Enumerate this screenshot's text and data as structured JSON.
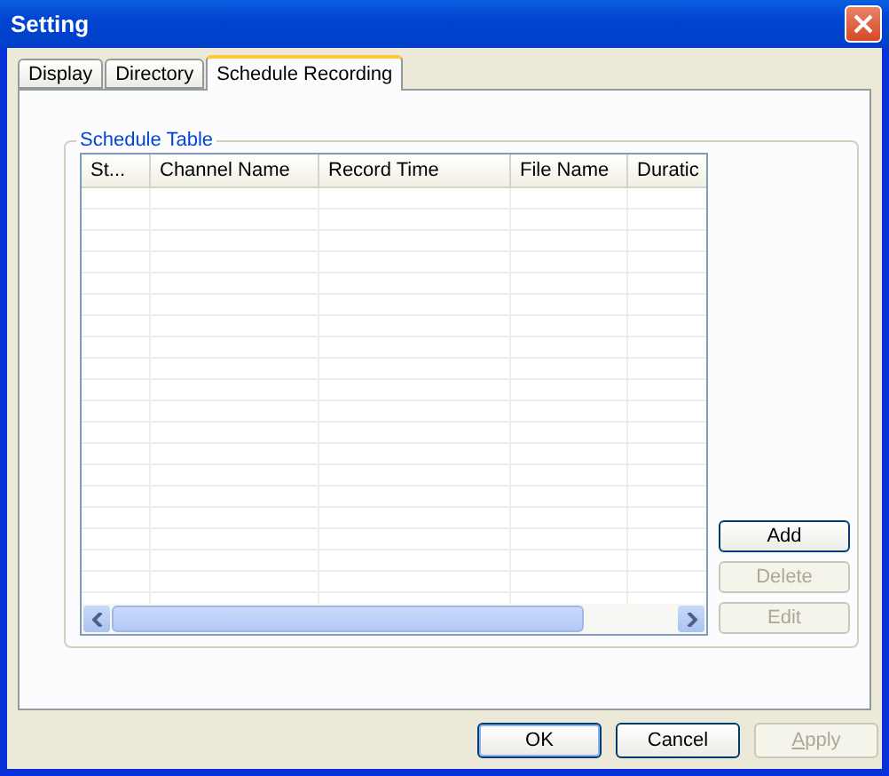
{
  "window": {
    "title": "Setting"
  },
  "tabs": [
    {
      "label": "Display",
      "selected": false
    },
    {
      "label": "Directory",
      "selected": false
    },
    {
      "label": "Schedule Recording",
      "selected": true
    }
  ],
  "group": {
    "label": "Schedule Table"
  },
  "table": {
    "columns": [
      "St...",
      "Channel Name",
      "Record Time",
      "File Name",
      "Duratic"
    ]
  },
  "side_buttons": [
    {
      "label": "Add",
      "disabled": false
    },
    {
      "label": "Delete",
      "disabled": true
    },
    {
      "label": "Edit",
      "disabled": true
    }
  ],
  "buttons": [
    {
      "label": "OK",
      "disabled": false,
      "default": true,
      "underline_first": false
    },
    {
      "label": "Cancel",
      "disabled": false,
      "default": false,
      "underline_first": false
    },
    {
      "label": "Apply",
      "disabled": true,
      "default": false,
      "underline_first": true
    }
  ]
}
